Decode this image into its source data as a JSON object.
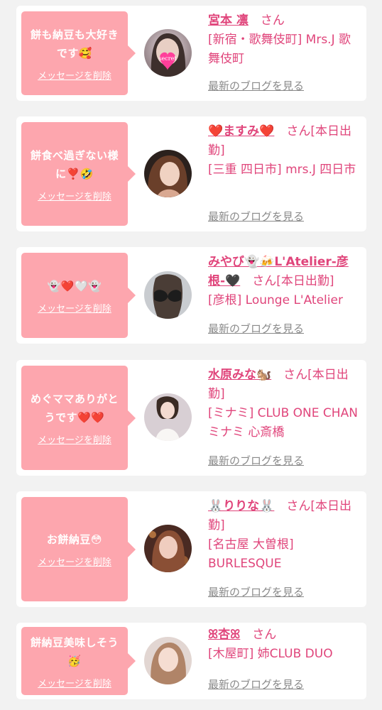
{
  "cards": [
    {
      "message": "餅も納豆も大好きです🥰",
      "delete_label": "メッセージを削除",
      "name": "宮本 凛",
      "suffix": "　さん",
      "store": "[新宿・歌舞伎町] Mrs.J 歌舞伎町",
      "blog_label": "最新のブログを見る"
    },
    {
      "message": "餅食べ過ぎない様に❣️🤣",
      "delete_label": "メッセージを削除",
      "name": "❤️ますみ❤️",
      "suffix": "　さん[本日出勤]",
      "store": "[三重 四日市] mrs.J 四日市",
      "blog_label": "最新のブログを見る"
    },
    {
      "message": "👻❤️🤍👻",
      "delete_label": "メッセージを削除",
      "name": "みやび👻🍻L'Atelier-彦根-🖤",
      "suffix": "　さん[本日出勤]",
      "store": "[彦根] Lounge L'Atelier",
      "blog_label": "最新のブログを見る"
    },
    {
      "message": "めぐママありがとうです❤️❤️",
      "delete_label": "メッセージを削除",
      "name": "水原みな🐿️",
      "suffix": "　さん[本日出勤]",
      "store": "[ミナミ] CLUB ONE CHAN ミナミ 心斎橋",
      "blog_label": "最新のブログを見る"
    },
    {
      "message": "お餅納豆😳",
      "delete_label": "メッセージを削除",
      "name": "🐰りりな🐰",
      "suffix": "　さん[本日出勤]",
      "store": "[名古屋 大曽根] BURLESQUE",
      "blog_label": "最新のブログを見る"
    },
    {
      "message": "餅納豆美味しそう🥳",
      "delete_label": "メッセージを削除",
      "name": "ꕤ杏ꕤ",
      "suffix": "　さん",
      "store": "[木屋町] 姉CLUB DUO",
      "blog_label": "最新のブログを見る"
    }
  ],
  "avatar_secret_label": "secret"
}
